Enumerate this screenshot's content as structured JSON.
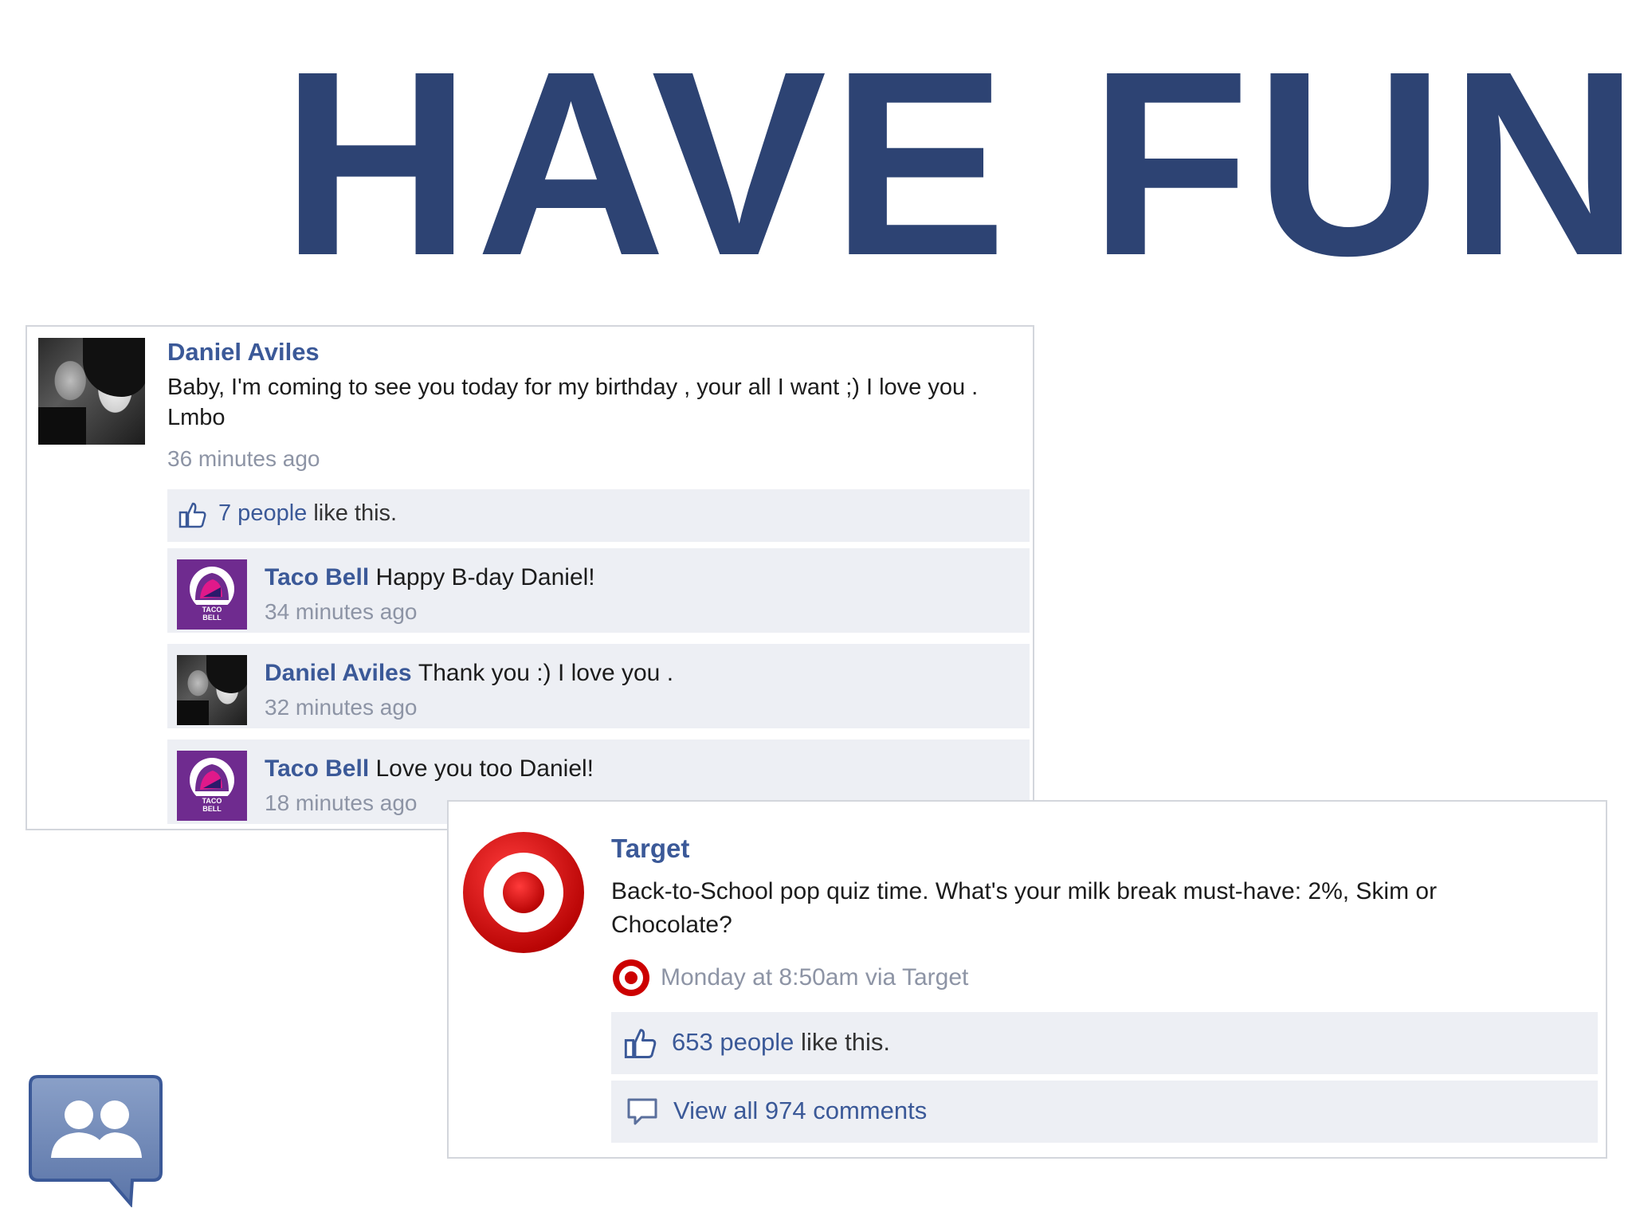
{
  "headline": "HAVE FUN",
  "post1": {
    "author": "Daniel Aviles",
    "message_line1": "Baby, I'm coming to see you today for my birthday , your all I want ;) I love you .",
    "message_line2": "Lmbo",
    "time": "36 minutes ago",
    "likes_link": "7 people",
    "likes_suffix": " like this.",
    "comments": [
      {
        "author": "Taco Bell",
        "text": "Happy B-day Daniel!",
        "time": "34 minutes ago",
        "avatar": "taco-bell-logo"
      },
      {
        "author": "Daniel Aviles",
        "text": "Thank you :) I love you .",
        "time": "32 minutes ago",
        "avatar": "profile-photo"
      },
      {
        "author": "Taco Bell",
        "text": "Love you too Daniel!",
        "time": "18 minutes ago",
        "avatar": "taco-bell-logo"
      }
    ],
    "taco_logo_text_1": "TACO",
    "taco_logo_text_2": "BELL"
  },
  "post2": {
    "author": "Target",
    "message_line1": "Back-to-School pop quiz time. What's your milk break must-have: 2%, Skim or",
    "message_line2": "Chocolate?",
    "time": "Monday at 8:50am via Target",
    "likes_link": "653 people",
    "likes_suffix": " like this.",
    "view_comments": "View all 974 comments"
  },
  "colors": {
    "headline": "#2d4373",
    "facebook_blue": "#3b5998",
    "target_red": "#cc0000",
    "taco_purple": "#6f2b8f",
    "bar_bg": "#edeff4"
  },
  "icons": [
    "thumbs-up-icon",
    "comment-bubble-icon",
    "target-logo",
    "taco-bell-logo",
    "groups-icon"
  ]
}
